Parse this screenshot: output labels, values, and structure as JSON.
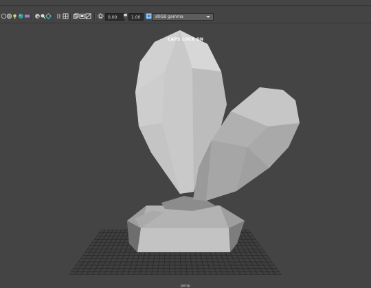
{
  "toolbar": {
    "exposure_value": "0.00",
    "gamma_value": "1.00",
    "color_space": "sRGB gamma",
    "icons": [
      "isolate-icon",
      "xray-icon",
      "light-icon",
      "texture-icon",
      "shadow-icon",
      "ambient-occlusion-icon",
      "motion-blur-icon",
      "antialias-icon",
      "grid-icon",
      "resolution-gate-icon",
      "safe-area-icon",
      "film-gate-icon",
      "field-chart-icon",
      "exposure-icon",
      "gamma-icon",
      "color-management-icon"
    ]
  },
  "viewport": {
    "status_message": "CAPS LOCK ON",
    "camera_label": "persp"
  },
  "colors": {
    "viewport_bg": "#444444",
    "grid_line": "#222222",
    "mesh_light": "#c9c9c9",
    "mesh_mid": "#b0b0b0",
    "mesh_dark": "#7a7a7a",
    "color_space_icon": "#3a88c9"
  }
}
